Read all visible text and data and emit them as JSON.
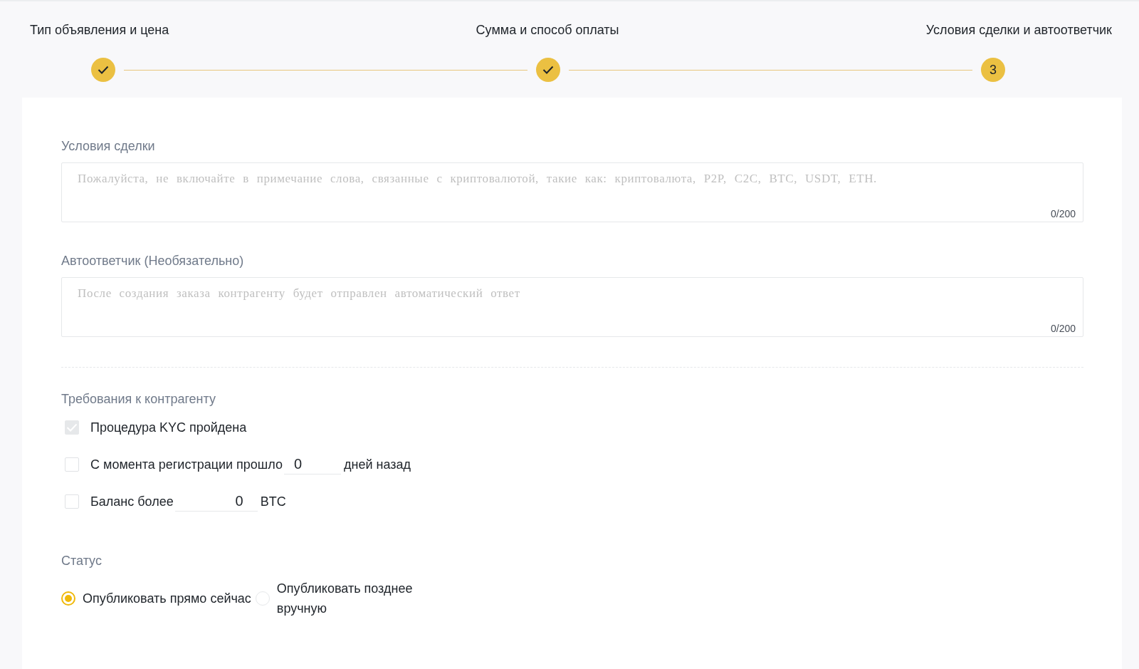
{
  "steps": [
    {
      "label": "Тип объявления и цена",
      "kind": "done"
    },
    {
      "label": "Сумма и способ оплаты",
      "kind": "done"
    },
    {
      "label": "Условия сделки и автоответчик",
      "kind": "current",
      "number": "3"
    }
  ],
  "fields": [
    {
      "label": "Условия сделки",
      "placeholder": "Пожалуйста, не включайте в примечание слова, связанные с криптовалютой, такие как: криптовалюта, P2P, C2C, BTC, USDT, ETH.",
      "counter": "0/200"
    },
    {
      "label": "Автоответчик (Необязательно)",
      "placeholder": "После создания заказа контрагенту будет отправлен автоматический ответ",
      "counter": "0/200"
    }
  ],
  "requirements": {
    "title": "Требования к контрагенту",
    "items": [
      {
        "kind": "plain",
        "label": "Процедура KYC пройдена",
        "checked": true,
        "disabled": true
      },
      {
        "kind": "input",
        "label": "С момента регистрации прошло",
        "value": "0",
        "suffix": "дней назад",
        "checked": false
      },
      {
        "kind": "input",
        "label": "Баланс более",
        "value": "0",
        "suffix": "BTC",
        "checked": false
      }
    ]
  },
  "status": {
    "title": "Статус",
    "options": [
      {
        "label": "Опубликовать прямо сейчас",
        "selected": true
      },
      {
        "label": "Опубликовать позднее вручную",
        "selected": false
      }
    ]
  }
}
